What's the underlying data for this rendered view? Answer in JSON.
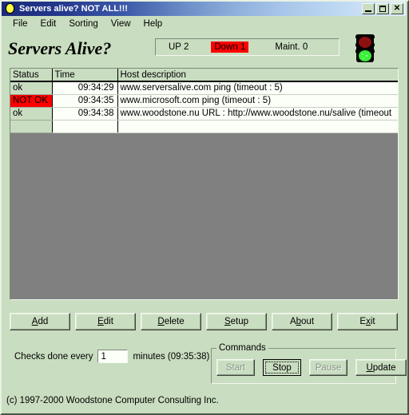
{
  "window": {
    "title": "Servers alive? NOT ALL!!!",
    "icon": "lightbulb-icon",
    "controls": {
      "minimize": "minimize-icon",
      "maximize": "maximize-icon",
      "close": "close-icon"
    }
  },
  "menu": {
    "items": [
      {
        "label": "File"
      },
      {
        "label": "Edit"
      },
      {
        "label": "Sorting"
      },
      {
        "label": "View"
      },
      {
        "label": "Help"
      }
    ]
  },
  "header": {
    "app_title": "Servers Alive?",
    "status": {
      "up_label": "UP  2",
      "down_label": "Down 1",
      "maint_label": "Maint. 0",
      "down_highlight_color": "#ff0000"
    },
    "traffic_light": {
      "icon": "traffic-light-icon",
      "red_on": false,
      "amber_on": false,
      "green_on": true,
      "green_color": "#3cf03c",
      "red_color": "#8d1010"
    }
  },
  "grid": {
    "columns": [
      {
        "key": "status",
        "label": "Status"
      },
      {
        "key": "time",
        "label": "Time"
      },
      {
        "key": "host",
        "label": "Host description"
      }
    ],
    "rows": [
      {
        "status": "ok",
        "time": "09:34:29",
        "host": "www.serversalive.com  ping   (timeout :  5)",
        "bad": false
      },
      {
        "status": "NOT OK",
        "time": "09:34:35",
        "host": "www.microsoft.com  ping   (timeout :  5)",
        "bad": true
      },
      {
        "status": "ok",
        "time": "09:34:38",
        "host": "www.woodstone.nu  URL : http://www.woodstone.nu/salive  (timeout",
        "bad": false
      },
      {
        "status": "",
        "time": "",
        "host": "",
        "bad": false
      }
    ],
    "background_color": "#808080"
  },
  "actions": {
    "buttons": [
      {
        "pre": "",
        "accel": "A",
        "post": "dd"
      },
      {
        "pre": "",
        "accel": "E",
        "post": "dit"
      },
      {
        "pre": "",
        "accel": "D",
        "post": "elete"
      },
      {
        "pre": "",
        "accel": "S",
        "post": "etup"
      },
      {
        "pre": "A",
        "accel": "b",
        "post": "out"
      },
      {
        "pre": "E",
        "accel": "x",
        "post": "it"
      }
    ]
  },
  "checks": {
    "prefix_label": "Checks done every",
    "interval_value": "1",
    "suffix_label": "minutes (09:35:38)"
  },
  "commands": {
    "legend": "Commands",
    "buttons": [
      {
        "label": "Start",
        "disabled": true,
        "focused": false
      },
      {
        "label": "Stop",
        "disabled": false,
        "focused": true
      },
      {
        "label": "Pause",
        "disabled": true,
        "focused": false
      },
      {
        "pre": "",
        "accel": "U",
        "post": "pdate",
        "label": "Update",
        "disabled": false,
        "focused": false,
        "wide": true
      }
    ]
  },
  "footer": {
    "copyright": "(c) 1997-2000 Woodstone Computer Consulting Inc."
  }
}
